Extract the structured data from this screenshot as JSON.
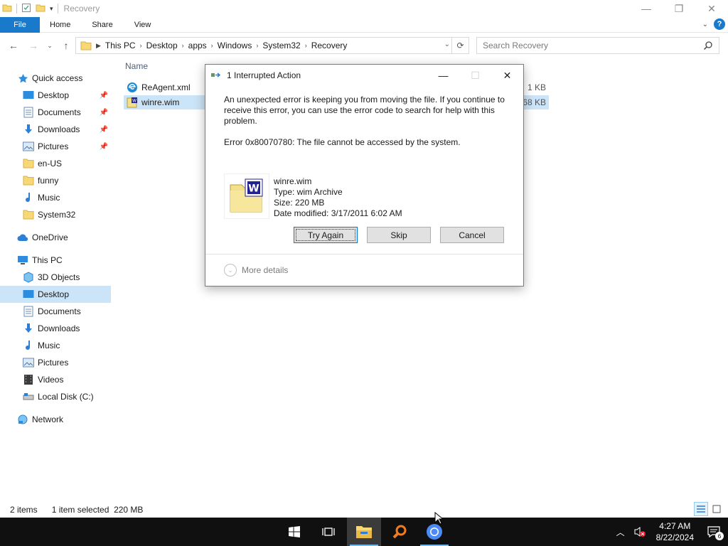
{
  "window": {
    "title": "Recovery",
    "controls": {
      "minimize": "—",
      "restore": "❐",
      "close": "✕"
    }
  },
  "ribbon": {
    "tabs": [
      "File",
      "Home",
      "Share",
      "View"
    ],
    "help": "?"
  },
  "address": {
    "crumbs": [
      "This PC",
      "Desktop",
      "apps",
      "Windows",
      "System32",
      "Recovery"
    ],
    "search_placeholder": "Search Recovery"
  },
  "nav": {
    "quick_access": "Quick access",
    "quick_items": [
      {
        "label": "Desktop",
        "icon": "desktop-icon",
        "pinned": true
      },
      {
        "label": "Documents",
        "icon": "documents-icon",
        "pinned": true
      },
      {
        "label": "Downloads",
        "icon": "downloads-icon",
        "pinned": true
      },
      {
        "label": "Pictures",
        "icon": "pictures-icon",
        "pinned": true
      },
      {
        "label": "en-US",
        "icon": "folder-icon",
        "pinned": false
      },
      {
        "label": "funny",
        "icon": "folder-icon",
        "pinned": false
      },
      {
        "label": "Music",
        "icon": "music-icon",
        "pinned": false
      },
      {
        "label": "System32",
        "icon": "folder-icon",
        "pinned": false
      }
    ],
    "onedrive": "OneDrive",
    "this_pc": "This PC",
    "pc_items": [
      {
        "label": "3D Objects",
        "icon": "3d-objects-icon"
      },
      {
        "label": "Desktop",
        "icon": "desktop-icon",
        "selected": true
      },
      {
        "label": "Documents",
        "icon": "documents-icon"
      },
      {
        "label": "Downloads",
        "icon": "downloads-icon"
      },
      {
        "label": "Music",
        "icon": "music-icon"
      },
      {
        "label": "Pictures",
        "icon": "pictures-icon"
      },
      {
        "label": "Videos",
        "icon": "videos-icon"
      },
      {
        "label": "Local Disk (C:)",
        "icon": "drive-icon"
      }
    ],
    "network": "Network"
  },
  "files": {
    "column_name": "Name",
    "rows": [
      {
        "name": "ReAgent.xml",
        "size": "1 KB",
        "selected": false
      },
      {
        "name": "winre.wim",
        "size": "68 KB",
        "selected": true
      }
    ]
  },
  "status": {
    "items": "2 items",
    "selection": "1 item selected  220 MB"
  },
  "dialog": {
    "title": "1 Interrupted Action",
    "message": "An unexpected error is keeping you from moving the file. If you continue to receive this error, you can use the error code to search for help with this problem.",
    "error": "Error 0x80070780: The file cannot be accessed by the system.",
    "file_name": "winre.wim",
    "file_type": "Type: wim Archive",
    "file_size": "Size: 220 MB",
    "file_date": "Date modified: 3/17/2011 6:02 AM",
    "btn_try_again": "Try Again",
    "btn_skip": "Skip",
    "btn_cancel": "Cancel",
    "more_details": "More details"
  },
  "taskbar": {
    "time": "4:27 AM",
    "date": "8/22/2024",
    "notification_count": "6"
  },
  "colors": {
    "accent": "#1979ca",
    "selection": "#cce4f7",
    "taskbar": "#101010"
  }
}
